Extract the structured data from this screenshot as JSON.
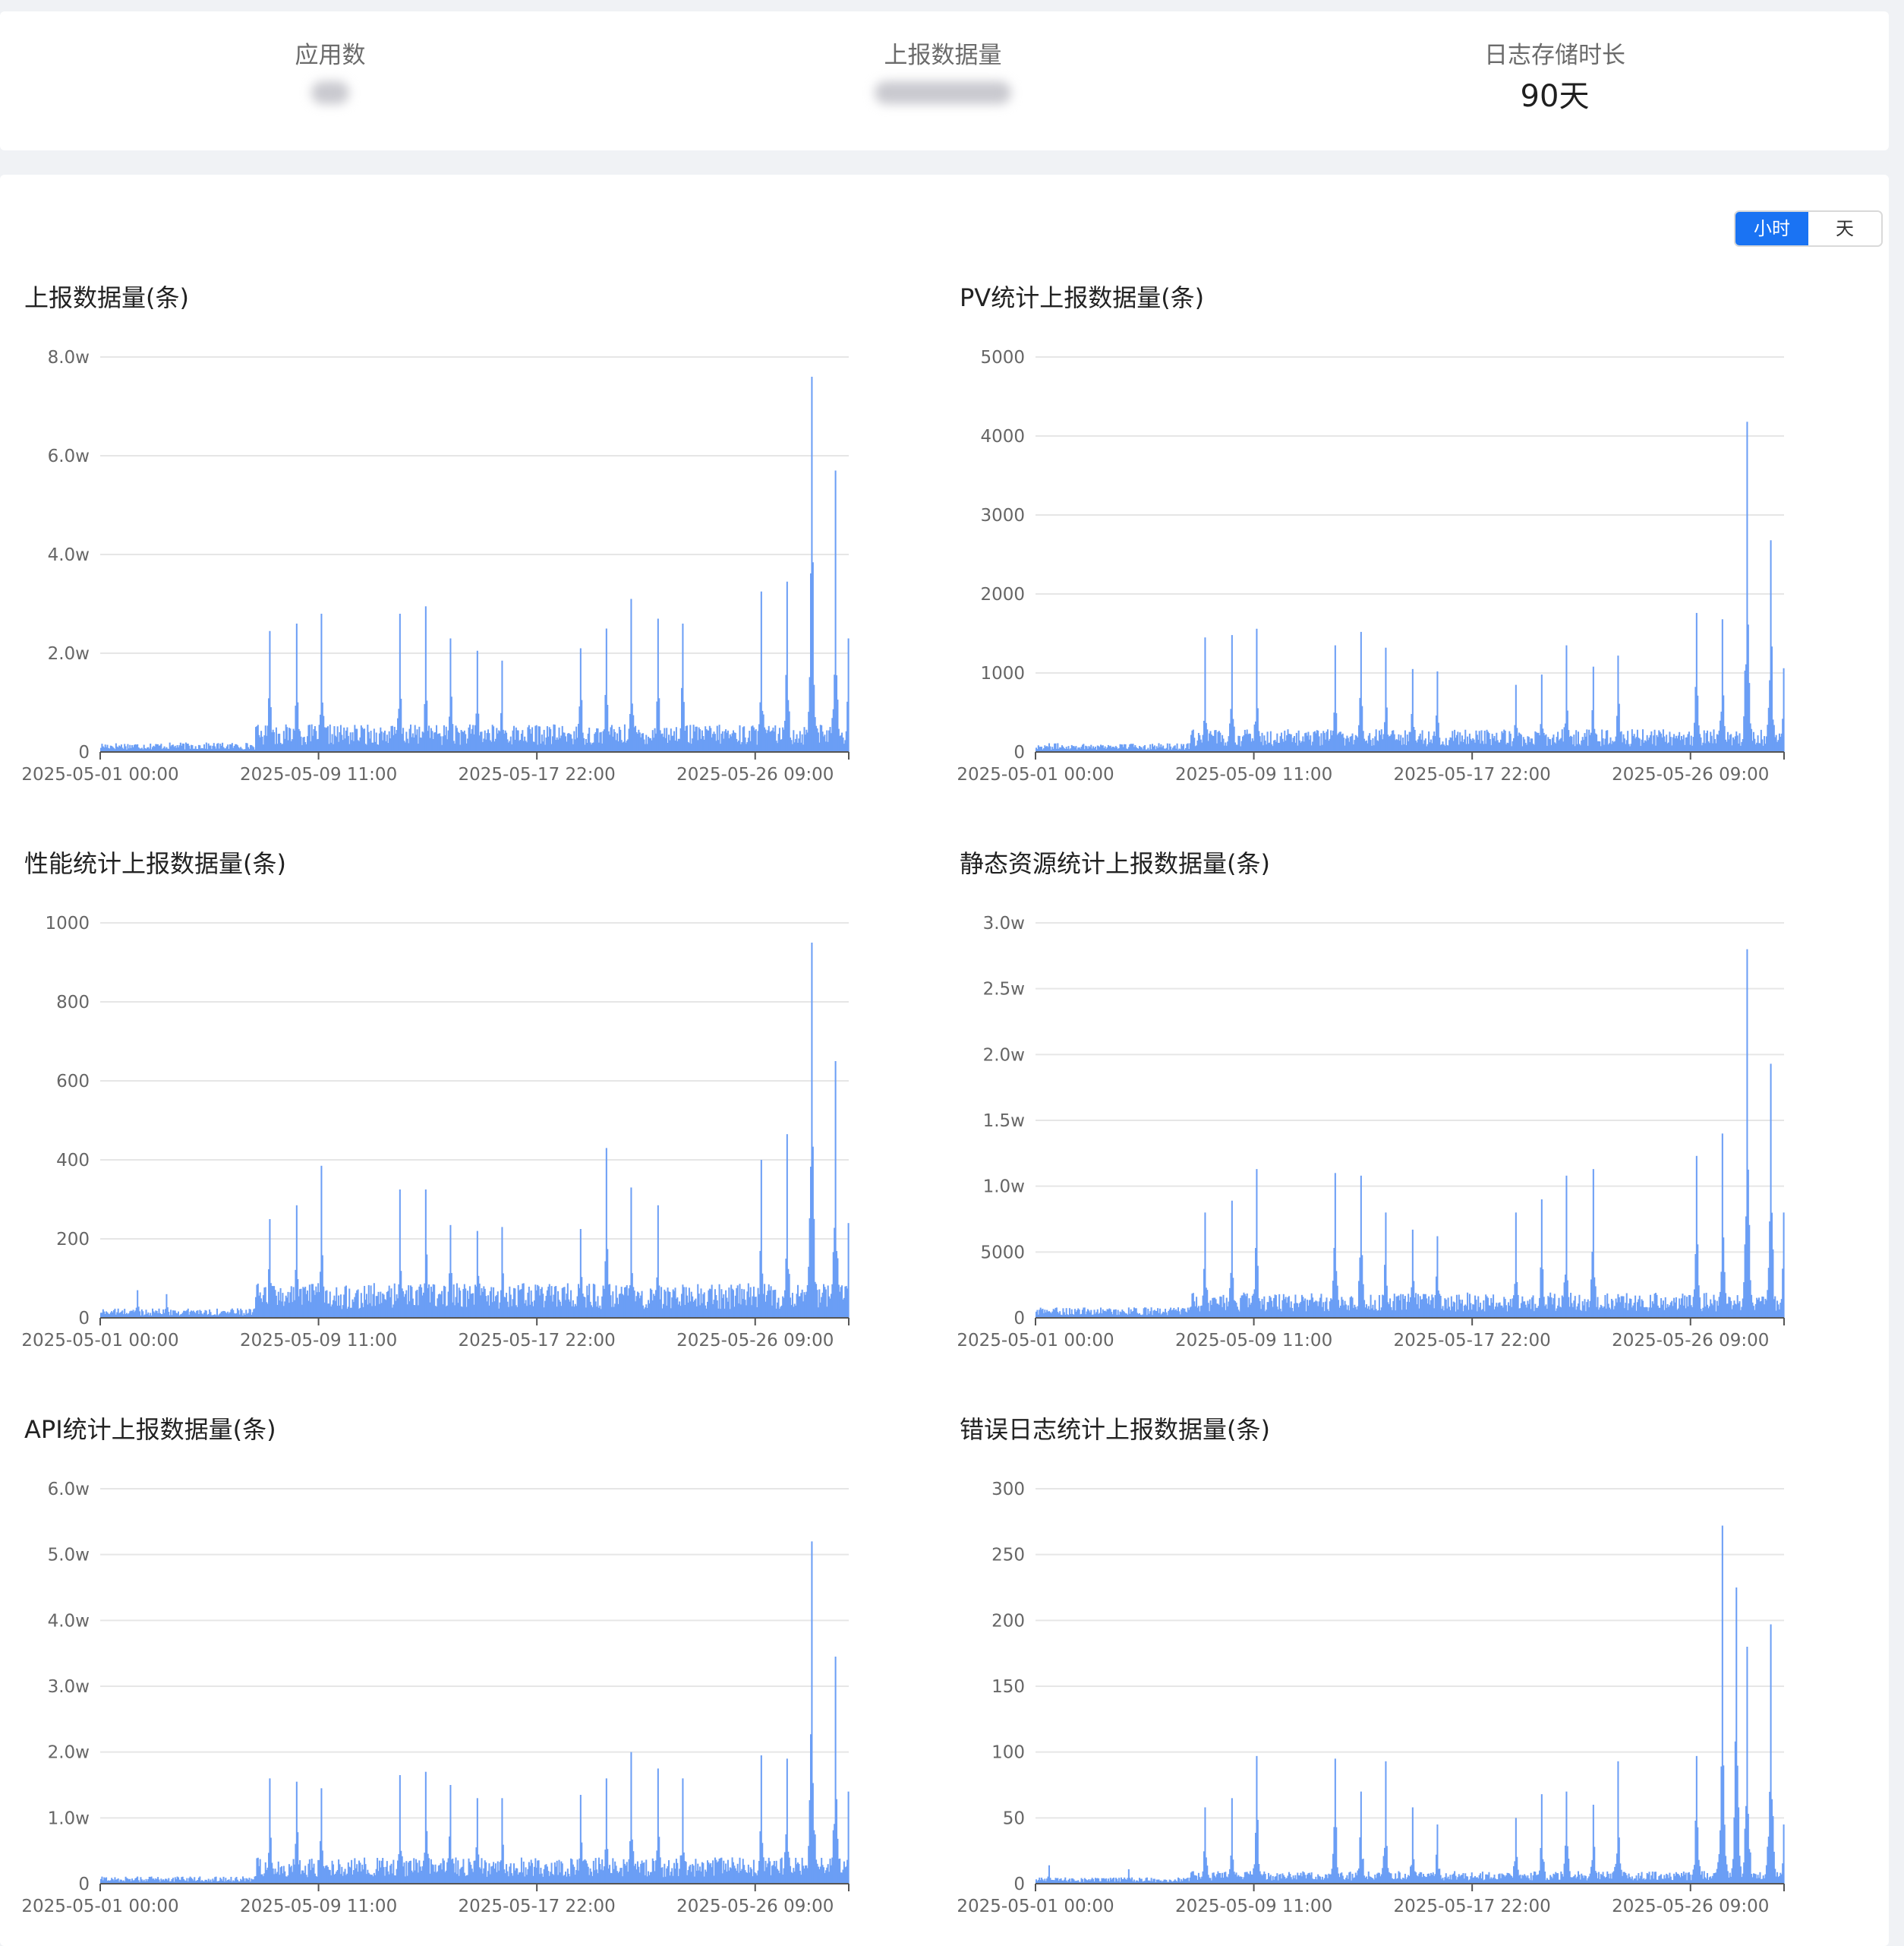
{
  "summary": {
    "apps_label": "应用数",
    "reports_label": "上报数据量",
    "retention_label": "日志存储时长",
    "retention_value": "90天"
  },
  "granularity": {
    "hour_label": "小时",
    "day_label": "天",
    "selected": "小时"
  },
  "theme": {
    "bar_color": "#6b9ef5",
    "accent": "#1a73f3"
  },
  "chart_data": [
    {
      "id": "total",
      "type": "bar",
      "title": "上报数据量(条)",
      "ylim": [
        0,
        80000
      ],
      "yticks": [
        "0",
        "2.0w",
        "4.0w",
        "6.0w",
        "8.0w"
      ],
      "x_start": "2025-05-01 00:00",
      "x_end": "2025-05-30 00:00",
      "interval": "1h",
      "xticks": [
        "2025-05-01 00:00",
        "2025-05-09 11:00",
        "2025-05-17 22:00",
        "2025-05-26 09:00"
      ],
      "baseline": 1200,
      "busy_baseline": 3500,
      "peaks": [
        {
          "t": "2025-05-07 13:00",
          "v": 24500
        },
        {
          "t": "2025-05-08 14:00",
          "v": 26000
        },
        {
          "t": "2025-05-09 13:00",
          "v": 28000
        },
        {
          "t": "2025-05-12 14:00",
          "v": 28000
        },
        {
          "t": "2025-05-13 14:00",
          "v": 29500
        },
        {
          "t": "2025-05-14 13:00",
          "v": 23000
        },
        {
          "t": "2025-05-15 14:00",
          "v": 20500
        },
        {
          "t": "2025-05-16 13:00",
          "v": 18500
        },
        {
          "t": "2025-05-19 14:00",
          "v": 21000
        },
        {
          "t": "2025-05-20 14:00",
          "v": 25000
        },
        {
          "t": "2025-05-21 13:00",
          "v": 31000
        },
        {
          "t": "2025-05-22 14:00",
          "v": 27000
        },
        {
          "t": "2025-05-23 13:00",
          "v": 26000
        },
        {
          "t": "2025-05-26 14:00",
          "v": 32500
        },
        {
          "t": "2025-05-27 14:00",
          "v": 34500
        },
        {
          "t": "2025-05-28 13:00",
          "v": 76000
        },
        {
          "t": "2025-05-29 11:00",
          "v": 57000
        },
        {
          "t": "2025-05-29 23:00",
          "v": 23000
        }
      ]
    },
    {
      "id": "pv",
      "type": "bar",
      "title": "PV统计上报数据量(条)",
      "ylim": [
        0,
        5000
      ],
      "yticks": [
        "0",
        "1000",
        "2000",
        "3000",
        "4000",
        "5000"
      ],
      "x_start": "2025-05-01 00:00",
      "x_end": "2025-05-30 00:00",
      "interval": "1h",
      "xticks": [
        "2025-05-01 00:00",
        "2025-05-09 11:00",
        "2025-05-17 22:00",
        "2025-05-26 09:00"
      ],
      "baseline": 70,
      "busy_baseline": 180,
      "peaks": [
        {
          "t": "2025-05-07 13:00",
          "v": 1450
        },
        {
          "t": "2025-05-08 14:00",
          "v": 1480
        },
        {
          "t": "2025-05-09 13:00",
          "v": 1560
        },
        {
          "t": "2025-05-12 14:00",
          "v": 1350
        },
        {
          "t": "2025-05-13 14:00",
          "v": 1520
        },
        {
          "t": "2025-05-14 13:00",
          "v": 1320
        },
        {
          "t": "2025-05-15 14:00",
          "v": 1050
        },
        {
          "t": "2025-05-16 13:00",
          "v": 1020
        },
        {
          "t": "2025-05-19 14:00",
          "v": 850
        },
        {
          "t": "2025-05-20 14:00",
          "v": 980
        },
        {
          "t": "2025-05-21 13:00",
          "v": 1350
        },
        {
          "t": "2025-05-22 14:00",
          "v": 1080
        },
        {
          "t": "2025-05-23 13:00",
          "v": 1220
        },
        {
          "t": "2025-05-26 14:00",
          "v": 1760
        },
        {
          "t": "2025-05-27 14:00",
          "v": 1680
        },
        {
          "t": "2025-05-28 13:00",
          "v": 4180
        },
        {
          "t": "2025-05-29 11:00",
          "v": 2680
        },
        {
          "t": "2025-05-29 23:00",
          "v": 1060
        }
      ]
    },
    {
      "id": "perf",
      "type": "bar",
      "title": "性能统计上报数据量(条)",
      "ylim": [
        0,
        1000
      ],
      "yticks": [
        "0",
        "200",
        "400",
        "600",
        "800",
        "1000"
      ],
      "x_start": "2025-05-01 00:00",
      "x_end": "2025-05-30 00:00",
      "interval": "1h",
      "xticks": [
        "2025-05-01 00:00",
        "2025-05-09 11:00",
        "2025-05-17 22:00",
        "2025-05-26 09:00"
      ],
      "baseline": 15,
      "busy_baseline": 55,
      "peaks": [
        {
          "t": "2025-05-02 10:00",
          "v": 70
        },
        {
          "t": "2025-05-03 13:00",
          "v": 60
        },
        {
          "t": "2025-05-07 13:00",
          "v": 250
        },
        {
          "t": "2025-05-08 14:00",
          "v": 285
        },
        {
          "t": "2025-05-09 13:00",
          "v": 385
        },
        {
          "t": "2025-05-12 14:00",
          "v": 325
        },
        {
          "t": "2025-05-13 14:00",
          "v": 325
        },
        {
          "t": "2025-05-14 13:00",
          "v": 235
        },
        {
          "t": "2025-05-15 14:00",
          "v": 220
        },
        {
          "t": "2025-05-16 13:00",
          "v": 230
        },
        {
          "t": "2025-05-19 14:00",
          "v": 225
        },
        {
          "t": "2025-05-20 14:00",
          "v": 430
        },
        {
          "t": "2025-05-21 13:00",
          "v": 330
        },
        {
          "t": "2025-05-22 14:00",
          "v": 285
        },
        {
          "t": "2025-05-26 14:00",
          "v": 400
        },
        {
          "t": "2025-05-27 14:00",
          "v": 465
        },
        {
          "t": "2025-05-28 13:00",
          "v": 950
        },
        {
          "t": "2025-05-29 11:00",
          "v": 650
        },
        {
          "t": "2025-05-29 23:00",
          "v": 240
        }
      ]
    },
    {
      "id": "static",
      "type": "bar",
      "title": "静态资源统计上报数据量(条)",
      "ylim": [
        0,
        30000
      ],
      "yticks": [
        "0",
        "5000",
        "1.0w",
        "1.5w",
        "2.0w",
        "2.5w",
        "3.0w"
      ],
      "x_start": "2025-05-01 00:00",
      "x_end": "2025-05-30 00:00",
      "interval": "1h",
      "xticks": [
        "2025-05-01 00:00",
        "2025-05-09 11:00",
        "2025-05-17 22:00",
        "2025-05-26 09:00"
      ],
      "baseline": 500,
      "busy_baseline": 1200,
      "peaks": [
        {
          "t": "2025-05-07 13:00",
          "v": 8000
        },
        {
          "t": "2025-05-08 14:00",
          "v": 8900
        },
        {
          "t": "2025-05-09 13:00",
          "v": 11300
        },
        {
          "t": "2025-05-12 14:00",
          "v": 11000
        },
        {
          "t": "2025-05-13 14:00",
          "v": 10800
        },
        {
          "t": "2025-05-14 13:00",
          "v": 8000
        },
        {
          "t": "2025-05-15 14:00",
          "v": 6700
        },
        {
          "t": "2025-05-16 13:00",
          "v": 6200
        },
        {
          "t": "2025-05-19 14:00",
          "v": 8000
        },
        {
          "t": "2025-05-20 14:00",
          "v": 9000
        },
        {
          "t": "2025-05-21 13:00",
          "v": 10800
        },
        {
          "t": "2025-05-22 14:00",
          "v": 11300
        },
        {
          "t": "2025-05-26 14:00",
          "v": 12300
        },
        {
          "t": "2025-05-27 14:00",
          "v": 14000
        },
        {
          "t": "2025-05-28 13:00",
          "v": 28000
        },
        {
          "t": "2025-05-29 11:00",
          "v": 19300
        },
        {
          "t": "2025-05-29 23:00",
          "v": 8000
        }
      ]
    },
    {
      "id": "api",
      "type": "bar",
      "title": "API统计上报数据量(条)",
      "ylim": [
        0,
        60000
      ],
      "yticks": [
        "0",
        "1.0w",
        "2.0w",
        "3.0w",
        "4.0w",
        "5.0w",
        "6.0w"
      ],
      "x_start": "2025-05-01 00:00",
      "x_end": "2025-05-30 00:00",
      "interval": "1h",
      "xticks": [
        "2025-05-01 00:00",
        "2025-05-09 11:00",
        "2025-05-17 22:00",
        "2025-05-26 09:00"
      ],
      "baseline": 700,
      "busy_baseline": 2500,
      "peaks": [
        {
          "t": "2025-05-07 13:00",
          "v": 16000
        },
        {
          "t": "2025-05-08 14:00",
          "v": 15500
        },
        {
          "t": "2025-05-09 13:00",
          "v": 14500
        },
        {
          "t": "2025-05-12 14:00",
          "v": 16500
        },
        {
          "t": "2025-05-13 14:00",
          "v": 17000
        },
        {
          "t": "2025-05-14 13:00",
          "v": 15000
        },
        {
          "t": "2025-05-15 14:00",
          "v": 13000
        },
        {
          "t": "2025-05-16 13:00",
          "v": 13000
        },
        {
          "t": "2025-05-19 14:00",
          "v": 13500
        },
        {
          "t": "2025-05-20 14:00",
          "v": 16000
        },
        {
          "t": "2025-05-21 13:00",
          "v": 20000
        },
        {
          "t": "2025-05-22 14:00",
          "v": 17500
        },
        {
          "t": "2025-05-23 13:00",
          "v": 16000
        },
        {
          "t": "2025-05-26 14:00",
          "v": 19500
        },
        {
          "t": "2025-05-27 14:00",
          "v": 19000
        },
        {
          "t": "2025-05-28 13:00",
          "v": 52000
        },
        {
          "t": "2025-05-29 11:00",
          "v": 34500
        },
        {
          "t": "2025-05-29 23:00",
          "v": 14000
        }
      ]
    },
    {
      "id": "error",
      "type": "bar",
      "title": "错误日志统计上报数据量(条)",
      "ylim": [
        0,
        300
      ],
      "yticks": [
        "0",
        "50",
        "100",
        "150",
        "200",
        "250",
        "300"
      ],
      "x_start": "2025-05-01 00:00",
      "x_end": "2025-05-30 00:00",
      "interval": "1h",
      "xticks": [
        "2025-05-01 00:00",
        "2025-05-09 11:00",
        "2025-05-17 22:00",
        "2025-05-26 09:00"
      ],
      "baseline": 3,
      "busy_baseline": 6,
      "peaks": [
        {
          "t": "2025-05-01 12:00",
          "v": 14
        },
        {
          "t": "2025-05-04 14:00",
          "v": 11
        },
        {
          "t": "2025-05-07 13:00",
          "v": 58
        },
        {
          "t": "2025-05-08 14:00",
          "v": 65
        },
        {
          "t": "2025-05-09 13:00",
          "v": 97
        },
        {
          "t": "2025-05-12 14:00",
          "v": 95
        },
        {
          "t": "2025-05-13 14:00",
          "v": 70
        },
        {
          "t": "2025-05-14 13:00",
          "v": 93
        },
        {
          "t": "2025-05-15 14:00",
          "v": 58
        },
        {
          "t": "2025-05-16 13:00",
          "v": 45
        },
        {
          "t": "2025-05-19 14:00",
          "v": 50
        },
        {
          "t": "2025-05-20 14:00",
          "v": 68
        },
        {
          "t": "2025-05-21 13:00",
          "v": 70
        },
        {
          "t": "2025-05-22 14:00",
          "v": 60
        },
        {
          "t": "2025-05-23 13:00",
          "v": 93
        },
        {
          "t": "2025-05-26 14:00",
          "v": 97
        },
        {
          "t": "2025-05-27 14:00",
          "v": 272
        },
        {
          "t": "2025-05-28 03:00",
          "v": 225
        },
        {
          "t": "2025-05-28 13:00",
          "v": 180
        },
        {
          "t": "2025-05-29 11:00",
          "v": 197
        },
        {
          "t": "2025-05-29 23:00",
          "v": 45
        }
      ]
    }
  ]
}
